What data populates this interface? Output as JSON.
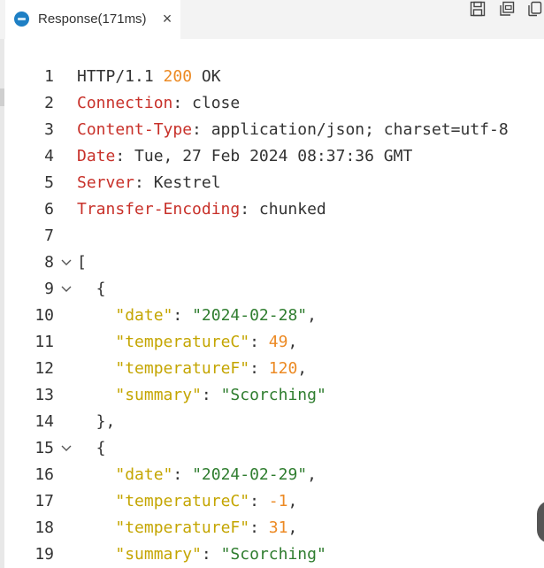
{
  "tab": {
    "title": "Response(171ms)",
    "close_glyph": "×",
    "icon": "api-client-icon"
  },
  "actions": [
    {
      "name": "save-icon"
    },
    {
      "name": "copy-all-icon"
    },
    {
      "name": "copy-icon"
    }
  ],
  "colors": {
    "header_name": "#c8312a",
    "status_code": "#ec8a24",
    "json_key": "#c4a500",
    "json_string": "#2f7d2f",
    "json_number": "#ec8a24",
    "scroll_thumb": "#555555"
  },
  "lines": [
    {
      "n": "1",
      "parts": [
        {
          "t": "HTTP/1.1 ",
          "c": "k-plain"
        },
        {
          "t": "200",
          "c": "k-orange"
        },
        {
          "t": " OK",
          "c": "k-plain"
        }
      ]
    },
    {
      "n": "2",
      "parts": [
        {
          "t": "Connection",
          "c": "k-red"
        },
        {
          "t": ": close",
          "c": "k-plain"
        }
      ]
    },
    {
      "n": "3",
      "parts": [
        {
          "t": "Content-Type",
          "c": "k-red"
        },
        {
          "t": ": application/json; charset=utf-8",
          "c": "k-plain"
        }
      ]
    },
    {
      "n": "4",
      "parts": [
        {
          "t": "Date",
          "c": "k-red"
        },
        {
          "t": ": Tue, 27 Feb 2024 08:37:36 GMT",
          "c": "k-plain"
        }
      ]
    },
    {
      "n": "5",
      "parts": [
        {
          "t": "Server",
          "c": "k-red"
        },
        {
          "t": ": Kestrel",
          "c": "k-plain"
        }
      ]
    },
    {
      "n": "6",
      "parts": [
        {
          "t": "Transfer-Encoding",
          "c": "k-red"
        },
        {
          "t": ": chunked",
          "c": "k-plain"
        }
      ]
    },
    {
      "n": "7",
      "parts": []
    },
    {
      "n": "8",
      "fold": true,
      "parts": [
        {
          "t": "[",
          "c": "k-punct"
        }
      ]
    },
    {
      "n": "9",
      "fold": true,
      "parts": [
        {
          "t": "  {",
          "c": "k-punct"
        }
      ]
    },
    {
      "n": "10",
      "parts": [
        {
          "t": "    ",
          "c": "k-plain"
        },
        {
          "t": "\"date\"",
          "c": "k-key"
        },
        {
          "t": ": ",
          "c": "k-punct"
        },
        {
          "t": "\"2024-02-28\"",
          "c": "k-str"
        },
        {
          "t": ",",
          "c": "k-punct"
        }
      ]
    },
    {
      "n": "11",
      "parts": [
        {
          "t": "    ",
          "c": "k-plain"
        },
        {
          "t": "\"temperatureC\"",
          "c": "k-key"
        },
        {
          "t": ": ",
          "c": "k-punct"
        },
        {
          "t": "49",
          "c": "k-orange"
        },
        {
          "t": ",",
          "c": "k-punct"
        }
      ]
    },
    {
      "n": "12",
      "parts": [
        {
          "t": "    ",
          "c": "k-plain"
        },
        {
          "t": "\"temperatureF\"",
          "c": "k-key"
        },
        {
          "t": ": ",
          "c": "k-punct"
        },
        {
          "t": "120",
          "c": "k-orange"
        },
        {
          "t": ",",
          "c": "k-punct"
        }
      ]
    },
    {
      "n": "13",
      "parts": [
        {
          "t": "    ",
          "c": "k-plain"
        },
        {
          "t": "\"summary\"",
          "c": "k-key"
        },
        {
          "t": ": ",
          "c": "k-punct"
        },
        {
          "t": "\"Scorching\"",
          "c": "k-str"
        }
      ]
    },
    {
      "n": "14",
      "parts": [
        {
          "t": "  },",
          "c": "k-punct"
        }
      ]
    },
    {
      "n": "15",
      "fold": true,
      "parts": [
        {
          "t": "  {",
          "c": "k-punct"
        }
      ]
    },
    {
      "n": "16",
      "parts": [
        {
          "t": "    ",
          "c": "k-plain"
        },
        {
          "t": "\"date\"",
          "c": "k-key"
        },
        {
          "t": ": ",
          "c": "k-punct"
        },
        {
          "t": "\"2024-02-29\"",
          "c": "k-str"
        },
        {
          "t": ",",
          "c": "k-punct"
        }
      ]
    },
    {
      "n": "17",
      "parts": [
        {
          "t": "    ",
          "c": "k-plain"
        },
        {
          "t": "\"temperatureC\"",
          "c": "k-key"
        },
        {
          "t": ": ",
          "c": "k-punct"
        },
        {
          "t": "-1",
          "c": "k-orange"
        },
        {
          "t": ",",
          "c": "k-punct"
        }
      ]
    },
    {
      "n": "18",
      "parts": [
        {
          "t": "    ",
          "c": "k-plain"
        },
        {
          "t": "\"temperatureF\"",
          "c": "k-key"
        },
        {
          "t": ": ",
          "c": "k-punct"
        },
        {
          "t": "31",
          "c": "k-orange"
        },
        {
          "t": ",",
          "c": "k-punct"
        }
      ]
    },
    {
      "n": "19",
      "parts": [
        {
          "t": "    ",
          "c": "k-plain"
        },
        {
          "t": "\"summary\"",
          "c": "k-key"
        },
        {
          "t": ": ",
          "c": "k-punct"
        },
        {
          "t": "\"Scorching\"",
          "c": "k-str"
        }
      ]
    }
  ]
}
